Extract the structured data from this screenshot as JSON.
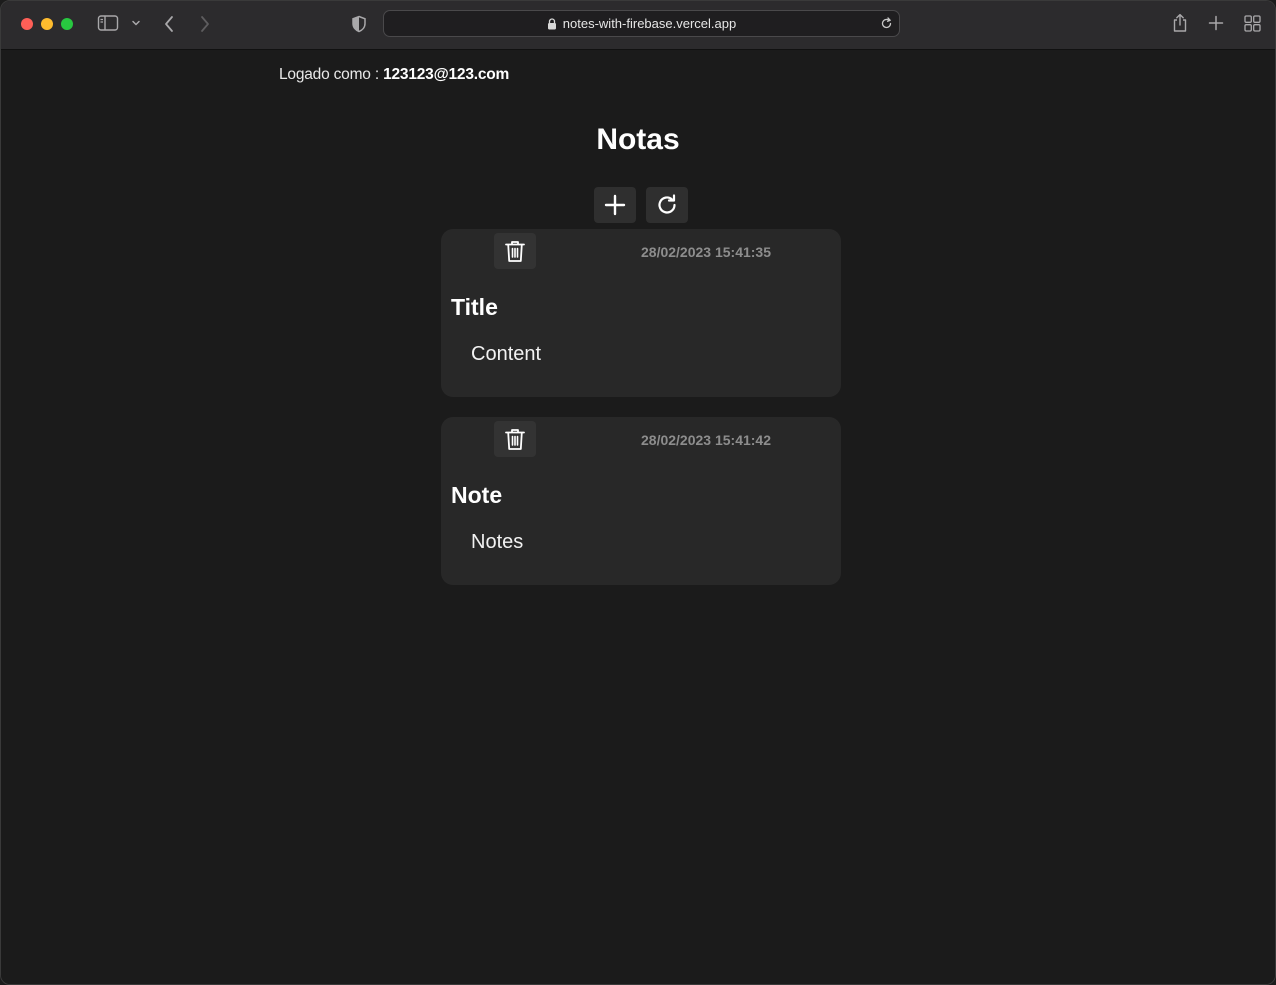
{
  "browser": {
    "url": "notes-with-firebase.vercel.app"
  },
  "header": {
    "login_prefix": "Logado como : ",
    "login_email": "123123@123.com",
    "title": "Notas"
  },
  "actions": {
    "add_icon": "plus-icon",
    "refresh_icon": "refresh-icon"
  },
  "notes": [
    {
      "date": "28/02/2023 15:41:35",
      "title": "Title",
      "content": "Content"
    },
    {
      "date": "28/02/2023 15:41:42",
      "title": "Note",
      "content": "Notes"
    }
  ]
}
